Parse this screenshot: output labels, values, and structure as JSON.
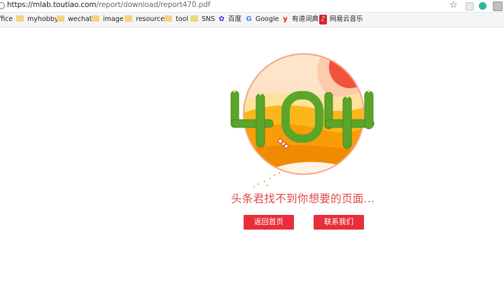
{
  "address_bar": {
    "url_host": "https://mlab.toutiao.com",
    "url_path": "/report/download/report470.pdf",
    "star_icon": "bookmark-star-icon"
  },
  "bookmarks": [
    {
      "label": "ffice",
      "icon": "folder-icon"
    },
    {
      "label": "myhobby",
      "icon": "folder-icon"
    },
    {
      "label": "wechat",
      "icon": "folder-icon"
    },
    {
      "label": "image",
      "icon": "folder-icon"
    },
    {
      "label": "resource",
      "icon": "folder-icon"
    },
    {
      "label": "tool",
      "icon": "folder-icon"
    },
    {
      "label": "SNS",
      "icon": "folder-icon"
    },
    {
      "label": "百度",
      "icon": "baidu-paw-icon"
    },
    {
      "label": "Google",
      "icon": "google-icon"
    },
    {
      "label": "有道词典",
      "icon": "youdao-icon"
    },
    {
      "label": "网易云音乐",
      "icon": "netease-music-icon"
    }
  ],
  "error_page": {
    "illustration_text": "404",
    "message": "头条君找不到你想要的页面...",
    "home_button": "返回首页",
    "contact_button": "联系我们"
  },
  "colors": {
    "accent_red": "#e82e3a",
    "message_red": "#e0474a",
    "cactus_green": "#5aa52a",
    "sand_orange": "#f7a400"
  }
}
